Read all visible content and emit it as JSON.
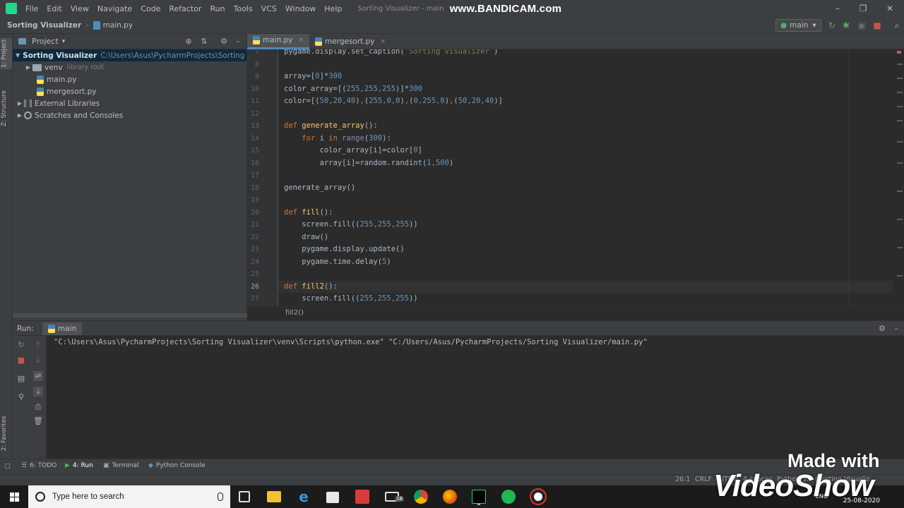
{
  "menubar": {
    "items": [
      "File",
      "Edit",
      "View",
      "Navigate",
      "Code",
      "Refactor",
      "Run",
      "Tools",
      "VCS",
      "Window",
      "Help"
    ],
    "title": "Sorting Visualizer - main",
    "watermark": "www.BANDICAM.com",
    "minimize": "–",
    "maximize": "❐",
    "close": "✕"
  },
  "navbar": {
    "project": "Sorting Visualizer",
    "file": "main.py",
    "run_config": "main",
    "run_config_arrow": "▾"
  },
  "leftstrip": {
    "project_tab": "1: Project",
    "structure_tab": "Z: Structure",
    "favorites_tab": "2: Favorites"
  },
  "project": {
    "title": "Project",
    "title_arrow": "▾",
    "tree": {
      "root_name": "Sorting Visualizer",
      "root_path": "C:\\Users\\Asus\\PycharmProjects\\Sorting Visualize",
      "venv": "venv",
      "venv_hint": "library root",
      "main": "main.py",
      "mergesort": "mergesort.py",
      "external": "External Libraries",
      "scratches": "Scratches and Consoles"
    }
  },
  "editor": {
    "tabs": [
      "main.py",
      "mergesort.py"
    ],
    "tab_close": "×",
    "footer_crumb": "fill2()",
    "line_numbers": [
      "7",
      "8",
      "9",
      "10",
      "11",
      "12",
      "13",
      "14",
      "15",
      "16",
      "17",
      "18",
      "19",
      "20",
      "21",
      "22",
      "23",
      "24",
      "25",
      "26",
      "27"
    ],
    "current_line": "26"
  },
  "run": {
    "label": "Run:",
    "tab": "main",
    "command": "\"C:\\Users\\Asus\\PycharmProjects\\Sorting Visualizer\\venv\\Scripts\\python.exe\" \"C:/Users/Asus/PycharmProjects/Sorting Visualizer/main.py\""
  },
  "bottom_tabs": {
    "todo": "6: TODO",
    "run": "4: Run",
    "terminal": "Terminal",
    "python_console": "Python Console"
  },
  "statusbar": {
    "position": "26:1",
    "line_sep": "CRLF",
    "encoding": "UTF-8",
    "indent": "4 spaces",
    "interpreter": "Python 3.7 (Sorting Visualizer)"
  },
  "taskbar": {
    "search_placeholder": "Type here to search",
    "mail_badge": "18",
    "lang": "ENG",
    "date": "25-08-2020"
  },
  "videoshow": {
    "made_with": "Made with",
    "brand": "VideoShow"
  },
  "colors": {
    "accent": "#4a88c7",
    "run_green": "#59a869",
    "stop_red": "#c75450",
    "keyword": "#cc7832",
    "number": "#6897bb",
    "string": "#6a8759",
    "function_def": "#ffc66d"
  }
}
